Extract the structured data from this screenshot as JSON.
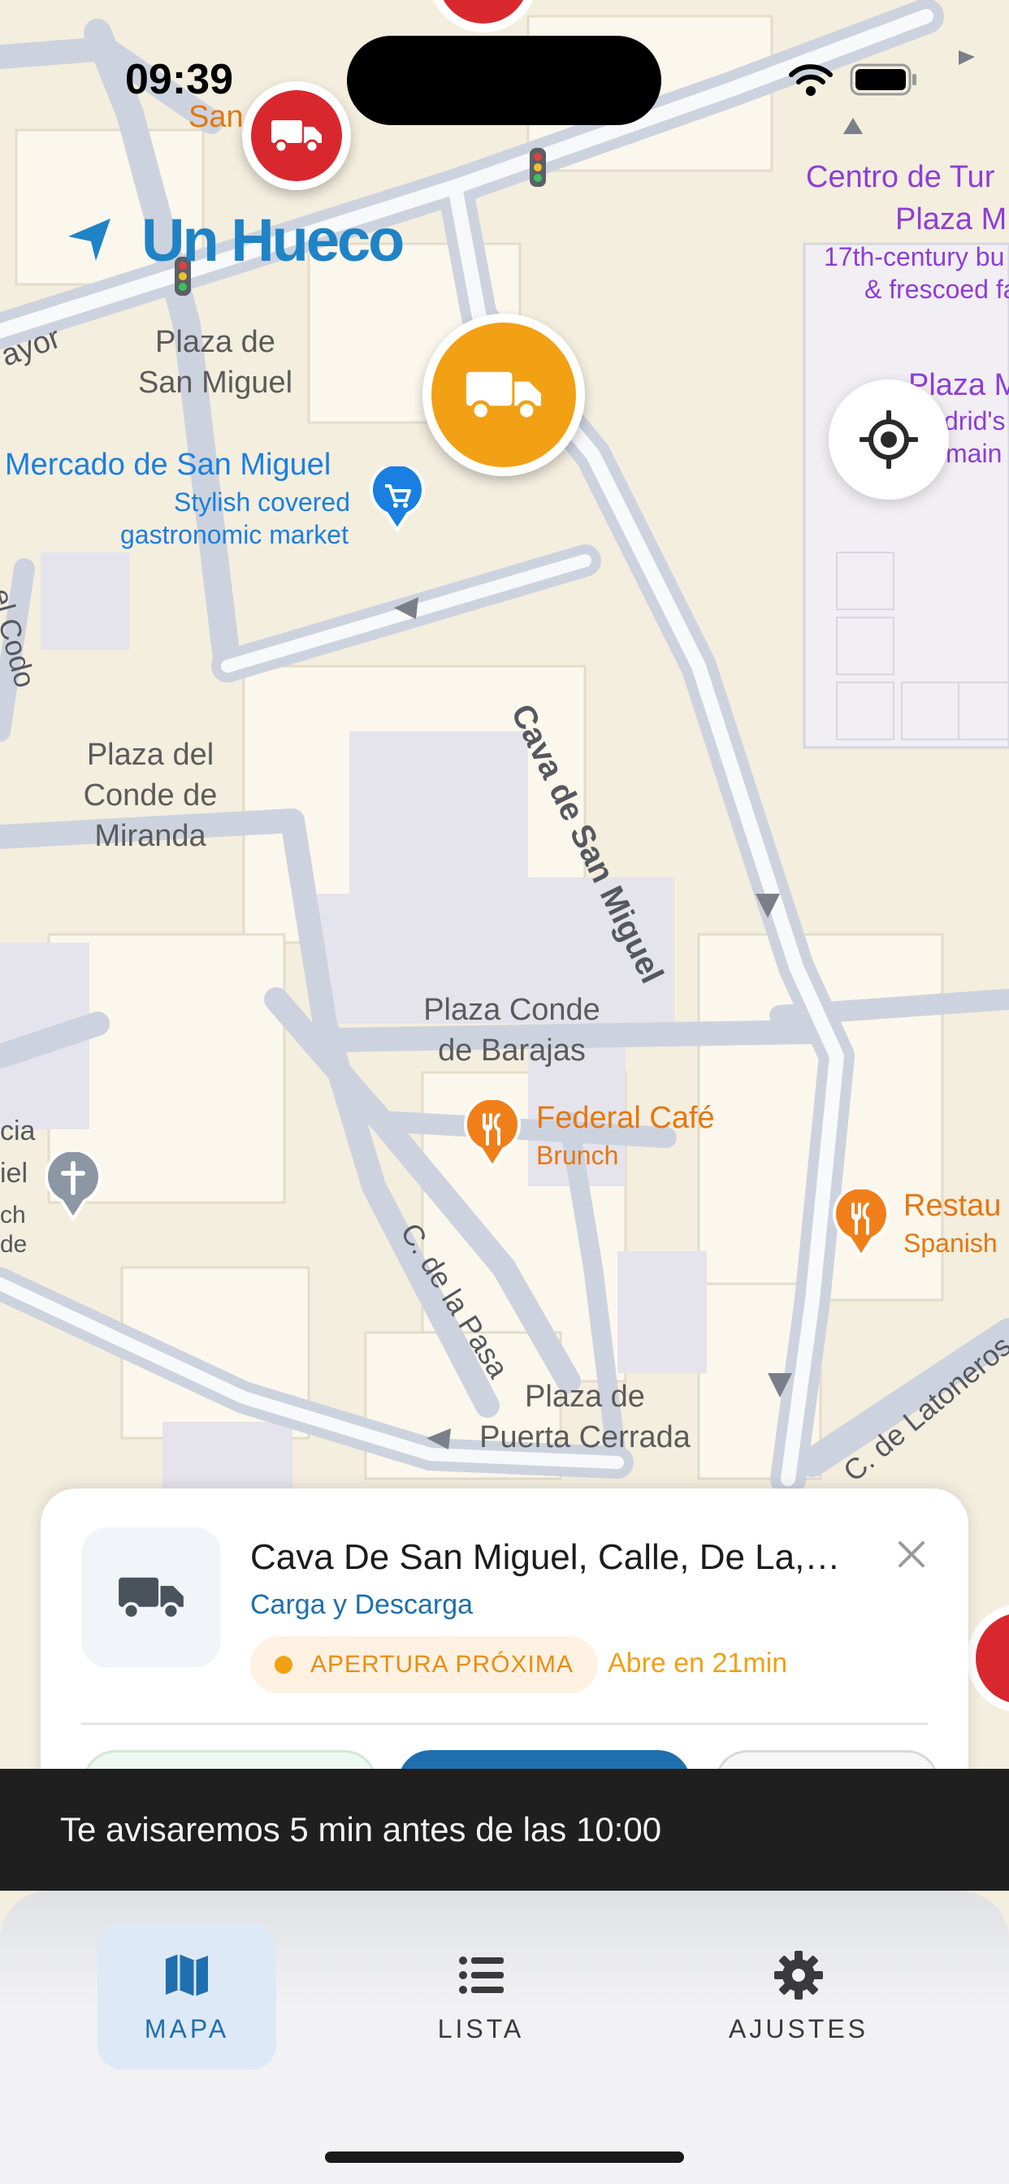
{
  "status_bar": {
    "time": "09:39"
  },
  "brand": {
    "name": "Un Hueco"
  },
  "map": {
    "places": [
      {
        "id": "plaza-san-miguel",
        "lines": [
          "Plaza de",
          "San Miguel"
        ]
      },
      {
        "id": "plaza-conde-miranda",
        "lines": [
          "Plaza del",
          "Conde de",
          "Miranda"
        ]
      },
      {
        "id": "plaza-conde-barajas",
        "lines": [
          "Plaza Conde",
          "de Barajas"
        ]
      },
      {
        "id": "plaza-puerta-cerrada",
        "lines": [
          "Plaza de",
          "Puerta Cerrada"
        ]
      }
    ],
    "streets": {
      "cava": "Cava de San Miguel",
      "pasa": "C. de la Pasa",
      "latoneros": "C. de Latoneros",
      "mayor": "ayor",
      "codo": "el Codo"
    },
    "pois": {
      "mercado": {
        "title": "Mercado de San Miguel",
        "sub1": "Stylish covered",
        "sub2": "gastronomic market"
      },
      "federal": {
        "title": "Federal Café",
        "sub": "Brunch"
      },
      "restau": {
        "title": "Restau",
        "sub": "Spanish"
      },
      "centro": {
        "title": "Centro de Tur",
        "sub1": "Plaza M",
        "sub2": "17th-century bu",
        "sub3": "& frescoed fa"
      },
      "plaza_m2": {
        "title": "Plaza M",
        "sub1": "drid's",
        "sub2": "main"
      },
      "san": {
        "title": "San"
      },
      "church_partial": [
        "cia",
        "iel",
        "ch",
        "de"
      ]
    }
  },
  "card": {
    "title": "Cava De San Miguel, Calle, De La,…",
    "subtitle": "Carga y Descarga",
    "badge": "APERTURA PRÓXIMA",
    "opens_in": "Abre en 21min"
  },
  "toast": {
    "message": "Te avisaremos 5 min antes de las 10:00"
  },
  "tabs": [
    {
      "label": "MAPA",
      "icon": "map-icon",
      "active": true
    },
    {
      "label": "LISTA",
      "icon": "list-icon",
      "active": false
    },
    {
      "label": "AJUSTES",
      "icon": "gear-icon",
      "active": false
    }
  ],
  "colors": {
    "brand_blue": "#1f83c6",
    "marker_orange": "#f2a014",
    "marker_red": "#d8282e",
    "poi_orange": "#e5770f",
    "poi_blue": "#1a7fe0",
    "poi_purple": "#8e3ed6"
  }
}
